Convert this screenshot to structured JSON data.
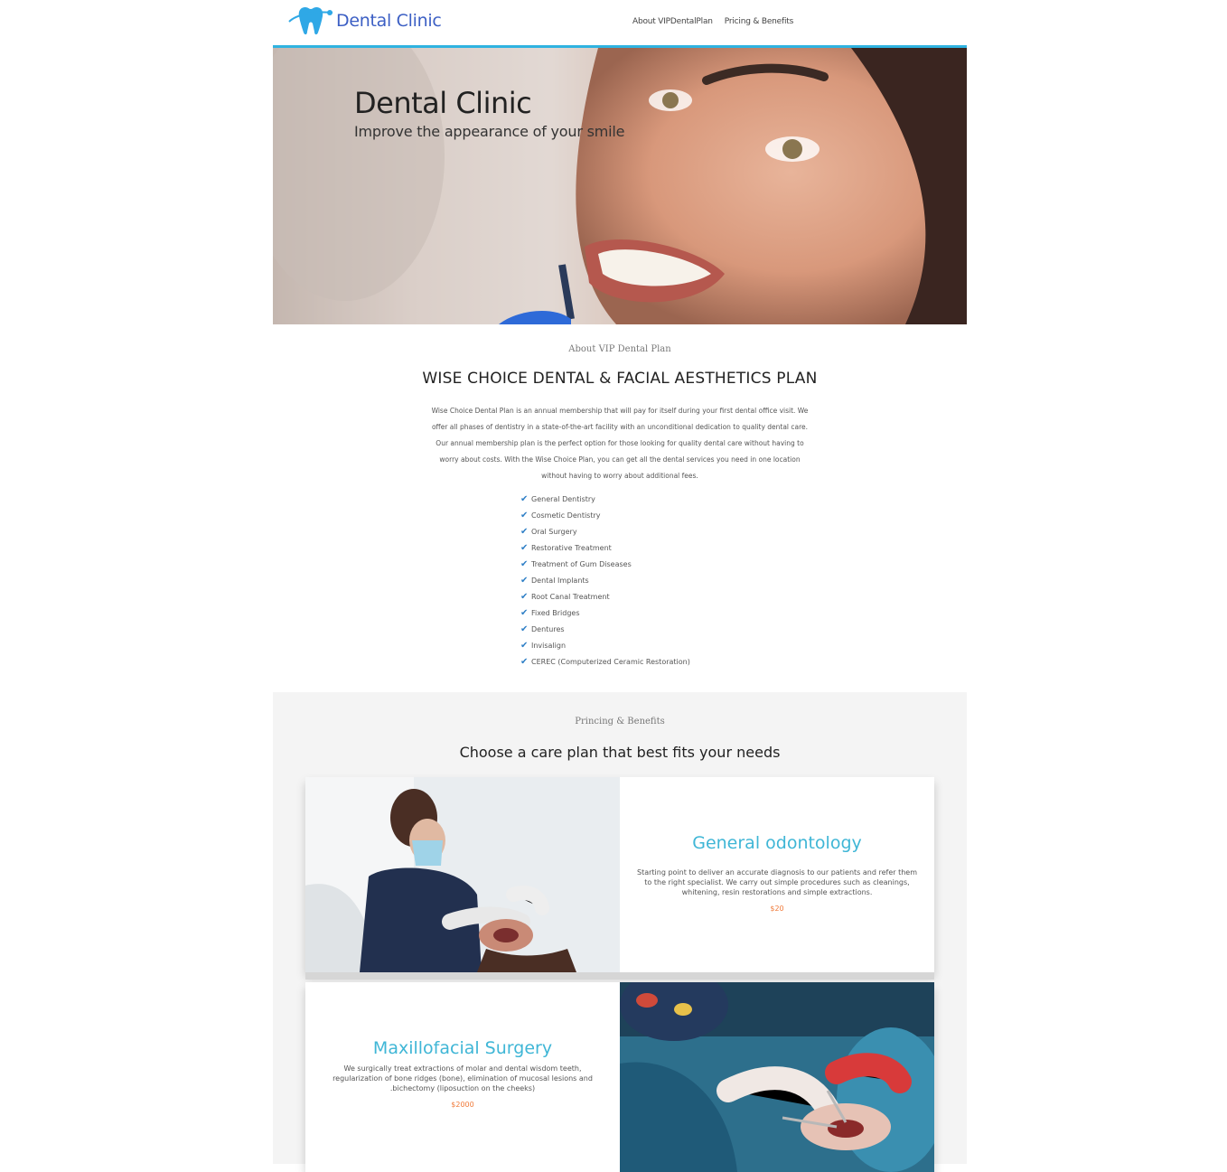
{
  "header": {
    "logo_text": "Dental Clinic",
    "nav": [
      "About VIPDentalPlan",
      "Pricing & Benefits"
    ]
  },
  "hero": {
    "title": "Dental Clinic",
    "subtitle": "Improve the appearance of your smile"
  },
  "about": {
    "label": "About VIP Dental Plan",
    "title": "WISE CHOICE DENTAL & FACIAL AESTHETICS PLAN",
    "text_lines": [
      "Wise Choice Dental Plan is an annual membership that will pay for itself during your first dental office visit. We",
      "offer all phases of dentistry in a state-of-the-art facility with an unconditional dedication to quality dental care.",
      "Our annual membership plan is the perfect option for those looking for quality dental care without having to",
      "worry about costs. With the Wise Choice Plan, you can get all the dental services you need in one location",
      "without having to worry about additional fees."
    ],
    "features": [
      "General Dentistry",
      "Cosmetic Dentistry",
      "Oral Surgery",
      "Restorative Treatment",
      "Treatment of Gum Diseases",
      "Dental Implants",
      "Root Canal Treatment",
      "Fixed Bridges",
      "Dentures",
      "Invisalign",
      "CEREC (Computerized Ceramic Restoration)"
    ]
  },
  "pricing": {
    "label": "Princing & Benefits",
    "title": "Choose a care plan that best fits your needs",
    "plans": [
      {
        "title": "General odontology",
        "desc_lines": [
          "Starting point to deliver an accurate diagnosis to our patients and refer them",
          "to the right specialist. We carry out simple procedures such as cleanings,",
          "whitening, resin restorations and simple extractions."
        ],
        "price": "$20"
      },
      {
        "title": "Maxillofacial Surgery",
        "desc_lines": [
          "We surgically treat extractions of molar and dental wisdom teeth,",
          "regularization of bone ridges (bone), elimination of mucosal lesions and",
          ".bichectomy (liposuction on the cheeks)"
        ],
        "price": "$2000"
      }
    ]
  },
  "colors": {
    "accent": "#2fb3e0",
    "logo": "#3c5fc4",
    "card_title": "#3fb6d6",
    "price": "#f07a3a",
    "check": "#2f7fc6"
  }
}
